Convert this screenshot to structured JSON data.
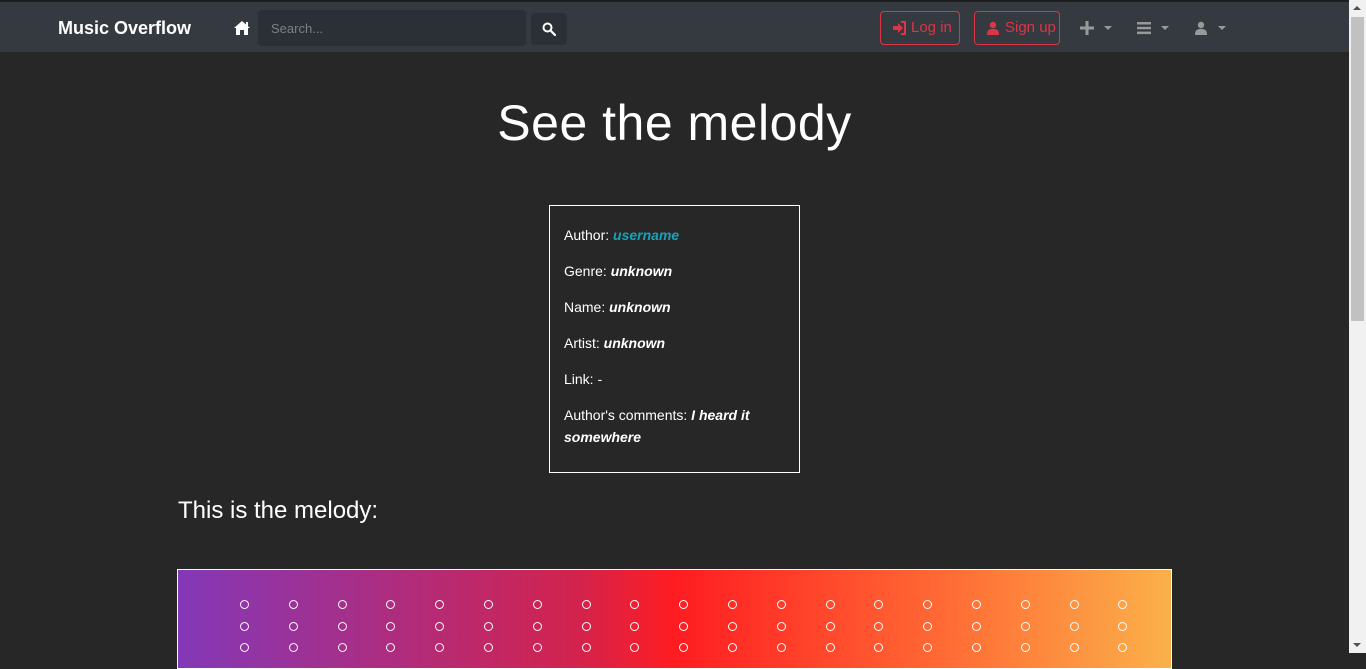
{
  "navbar": {
    "brand": "Music Overflow",
    "search_placeholder": "Search...",
    "login_label": "Log in",
    "signup_label": "Sign up",
    "icons": [
      "home-icon",
      "search-icon",
      "sign-in-icon",
      "user-icon",
      "plus-icon",
      "bars-icon",
      "user-icon"
    ]
  },
  "page": {
    "title": "See the melody"
  },
  "info": {
    "author_label": "Author:",
    "author_value": "username",
    "genre_label": "Genre:",
    "genre_value": "unknown",
    "name_label": "Name:",
    "name_value": "unknown",
    "artist_label": "Artist:",
    "artist_value": "unknown",
    "link_label": "Link:",
    "link_value": "-",
    "comments_label": "Author's comments:",
    "comments_value": "I heard it somewhere"
  },
  "melody": {
    "heading": "This is the melody:",
    "columns": 19,
    "visible_rows": 3
  },
  "colors": {
    "background": "#272727",
    "navbar": "#343a40",
    "danger": "#dc3545",
    "link": "#17a2b8"
  }
}
